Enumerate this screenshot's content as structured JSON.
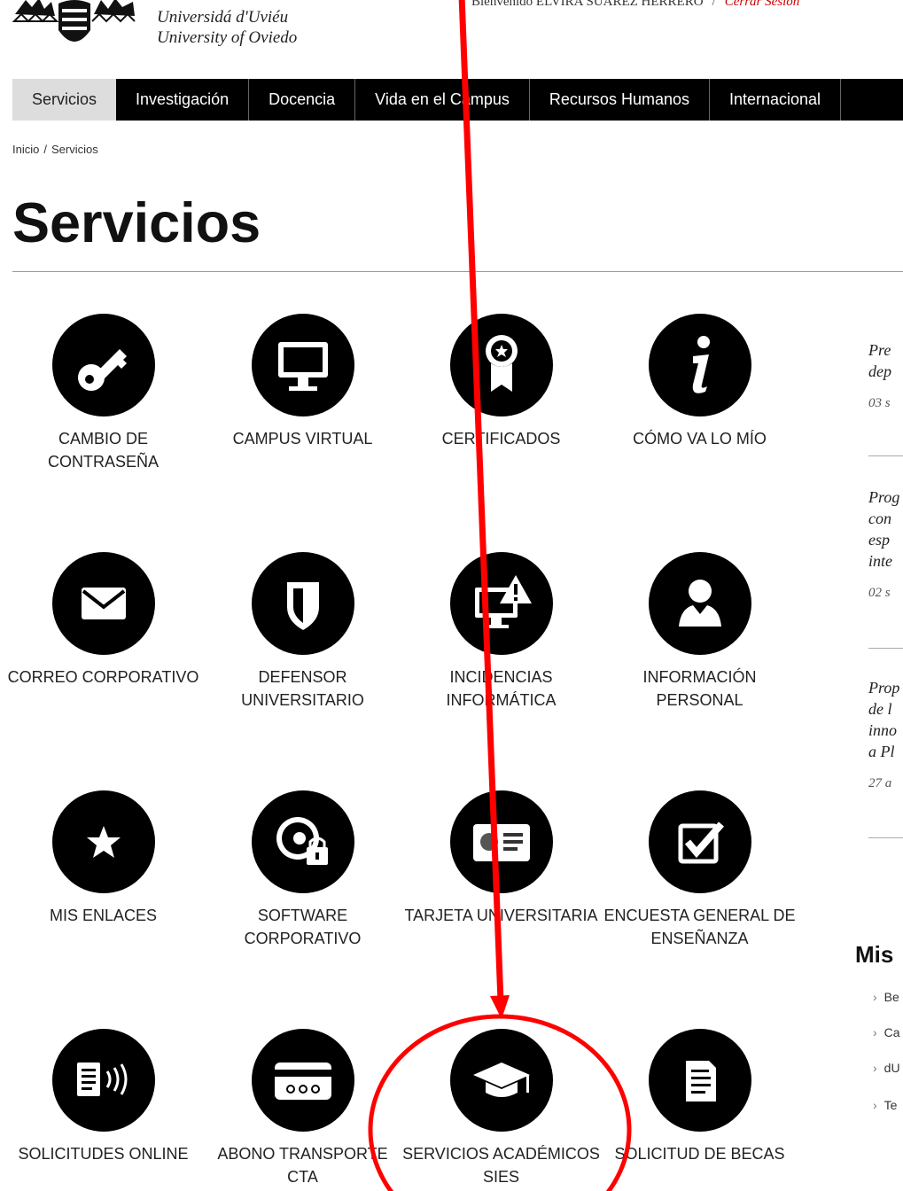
{
  "header": {
    "university_name_line1": "Universidá d'Uviéu",
    "university_name_line2": "University of Oviedo",
    "welcome_text": "Bienvenido ELVIRA SUÁREZ HERRERO",
    "separator": "/",
    "logout_label": "Cerrar Sesión"
  },
  "nav": {
    "items": [
      {
        "label": "Servicios"
      },
      {
        "label": "Investigación"
      },
      {
        "label": "Docencia"
      },
      {
        "label": "Vida en el Campus"
      },
      {
        "label": "Recursos Humanos"
      },
      {
        "label": "Internacional"
      }
    ]
  },
  "breadcrumb": {
    "home": "Inicio",
    "separator": "/",
    "current": "Servicios"
  },
  "page": {
    "title": "Servicios"
  },
  "services": [
    {
      "label": "CAMBIO DE CONTRASEÑA",
      "icon": "key-icon"
    },
    {
      "label": "CAMPUS VIRTUAL",
      "icon": "monitor-icon"
    },
    {
      "label": "CERTIFICADOS",
      "icon": "certificate-icon"
    },
    {
      "label": "CÓMO VA LO MÍO",
      "icon": "info-icon"
    },
    {
      "label": "CORREO CORPORATIVO",
      "icon": "envelope-icon"
    },
    {
      "label": "DEFENSOR UNIVERSITARIO",
      "icon": "shield-icon"
    },
    {
      "label": "INCIDENCIAS INFORMÁTICA",
      "icon": "computer-warning-icon"
    },
    {
      "label": "INFORMACIÓN PERSONAL",
      "icon": "person-icon"
    },
    {
      "label": "MIS ENLACES",
      "icon": "star-icon"
    },
    {
      "label": "SOFTWARE CORPORATIVO",
      "icon": "software-lock-icon"
    },
    {
      "label": "TARJETA UNIVERSITARIA",
      "icon": "id-card-icon"
    },
    {
      "label": "ENCUESTA GENERAL DE ENSEÑANZA",
      "icon": "checkbox-icon"
    },
    {
      "label": "SOLICITUDES ONLINE",
      "icon": "document-wireless-icon"
    },
    {
      "label": "ABONO TRANSPORTE CTA",
      "icon": "transport-card-icon"
    },
    {
      "label": "SERVICIOS ACADÉMICOS SIES",
      "icon": "graduation-cap-icon"
    },
    {
      "label": "SOLICITUD DE BECAS",
      "icon": "document-icon"
    }
  ],
  "news": [
    {
      "lines": [
        "Pre",
        "dep"
      ],
      "date": "03 s"
    },
    {
      "lines": [
        "Prog",
        "con",
        "esp",
        "inte"
      ],
      "date": "02 s"
    },
    {
      "lines": [
        "Prop",
        "de l",
        "inno",
        "a Pl"
      ],
      "date": "27 a"
    }
  ],
  "sidebar": {
    "title": "Mis",
    "links": [
      "Be",
      "Ca",
      "dU",
      "Te"
    ]
  },
  "annotation": {
    "color": "#ff0000"
  }
}
